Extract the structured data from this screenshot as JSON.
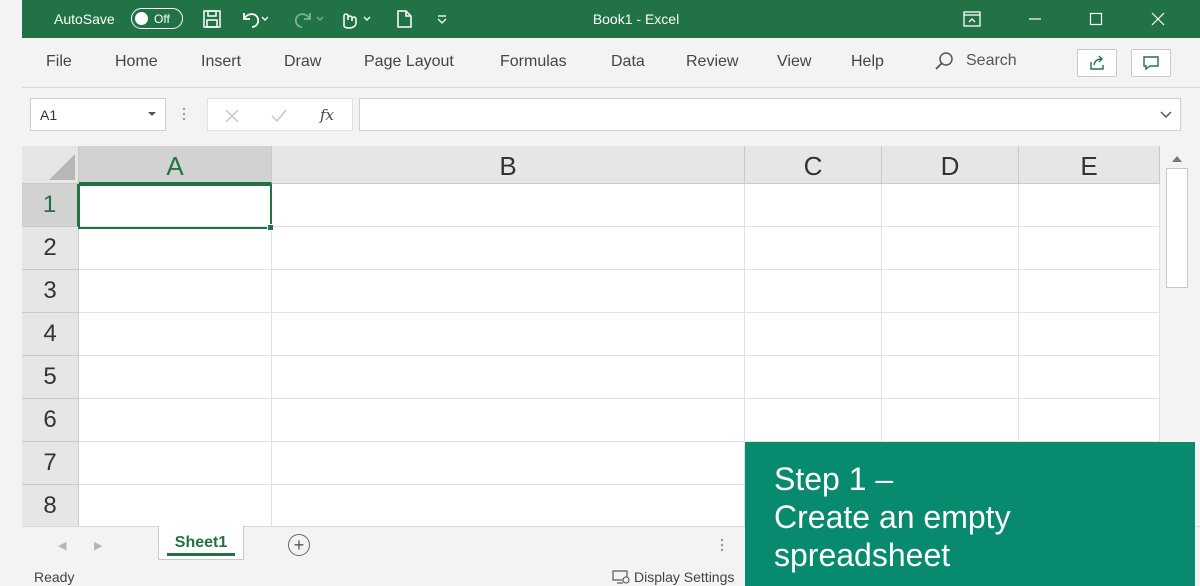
{
  "titlebar": {
    "autosave_label": "AutoSave",
    "autosave_state": "Off",
    "title": "Book1 - Excel",
    "icons": [
      "save-icon",
      "undo-icon",
      "redo-icon",
      "touch-mode-icon",
      "new-document-icon",
      "customize-toolbar-icon"
    ],
    "window_buttons": [
      "ribbon-display-options-icon",
      "minimize-icon",
      "maximize-icon",
      "close-icon"
    ]
  },
  "ribbon": {
    "tabs": [
      "File",
      "Home",
      "Insert",
      "Draw",
      "Page Layout",
      "Formulas",
      "Data",
      "Review",
      "View",
      "Help"
    ],
    "search_label": "Search",
    "buttons": [
      "share-icon",
      "comments-icon"
    ]
  },
  "formula_bar": {
    "name_box": "A1",
    "fx_label": "fx",
    "formula": ""
  },
  "grid": {
    "columns": [
      "A",
      "B",
      "C",
      "D",
      "E"
    ],
    "rows": [
      "1",
      "2",
      "3",
      "4",
      "5",
      "6",
      "7",
      "8"
    ],
    "active_cell": "A1"
  },
  "sheets": {
    "tabs": [
      "Sheet1"
    ],
    "active": "Sheet1"
  },
  "status": {
    "ready": "Ready",
    "display_settings": "Display Settings"
  },
  "callout": {
    "line1": "Step 1 –",
    "line2": "Create an empty",
    "line3": "spreadsheet"
  },
  "colors": {
    "excel_green": "#217346",
    "callout_bg": "#088a6e"
  }
}
